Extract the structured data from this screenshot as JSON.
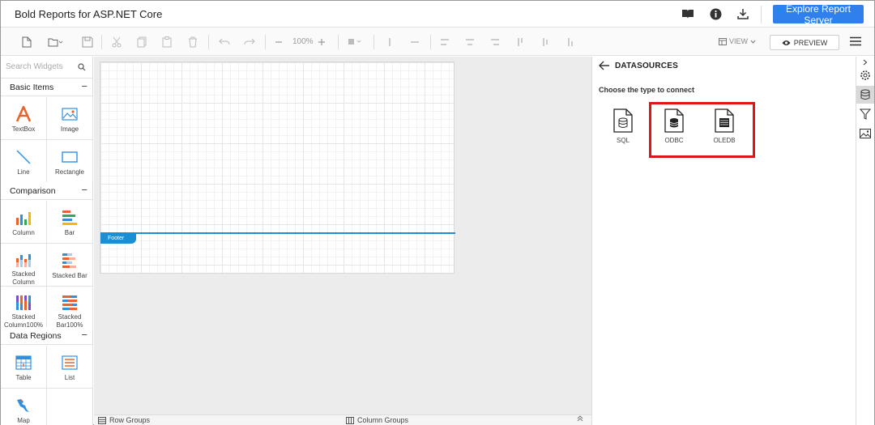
{
  "app": {
    "title": "Bold Reports for ASP.NET Core",
    "explore_label": "Explore Report Server"
  },
  "toolbar": {
    "zoom": "100%",
    "view_label": "VIEW",
    "preview_label": "PREVIEW"
  },
  "sidebar": {
    "search_placeholder": "Search Widgets",
    "categories": [
      {
        "label": "Basic Items",
        "collapse": "−"
      },
      {
        "label": "Comparison",
        "collapse": "−"
      },
      {
        "label": "Data Regions",
        "collapse": "−"
      }
    ],
    "widgets": [
      {
        "label": "TextBox",
        "icon": "textbox-icon"
      },
      {
        "label": "Image",
        "icon": "image-icon"
      },
      {
        "label": "Line",
        "icon": "line-icon"
      },
      {
        "label": "Rectangle",
        "icon": "rectangle-icon"
      },
      {
        "label": "Column",
        "icon": "column-chart-icon"
      },
      {
        "label": "Bar",
        "icon": "bar-chart-icon"
      },
      {
        "label": "Stacked Column",
        "icon": "stacked-column-icon"
      },
      {
        "label": "Stacked Bar",
        "icon": "stacked-bar-icon"
      },
      {
        "label": "Stacked Column100%",
        "icon": "stacked-column100-icon"
      },
      {
        "label": "Stacked Bar100%",
        "icon": "stacked-bar100-icon"
      },
      {
        "label": "Table",
        "icon": "table-icon"
      },
      {
        "label": "List",
        "icon": "list-icon"
      },
      {
        "label": "Map",
        "icon": "map-icon"
      }
    ]
  },
  "design": {
    "footer_label": "Footer"
  },
  "bottom": {
    "row_groups": "Row Groups",
    "column_groups": "Column Groups",
    "expand": "⌃"
  },
  "datasources": {
    "title": "DATASOURCES",
    "subtitle": "Choose the type to connect",
    "items": [
      {
        "label": "SQL",
        "icon": "sql-file-icon"
      },
      {
        "label": "ODBC",
        "icon": "odbc-file-icon"
      },
      {
        "label": "OLEDB",
        "icon": "oledb-file-icon"
      }
    ]
  },
  "colors": {
    "accent": "#2f80ed",
    "footer": "#1a8fd6",
    "highlight": "#e01616"
  }
}
